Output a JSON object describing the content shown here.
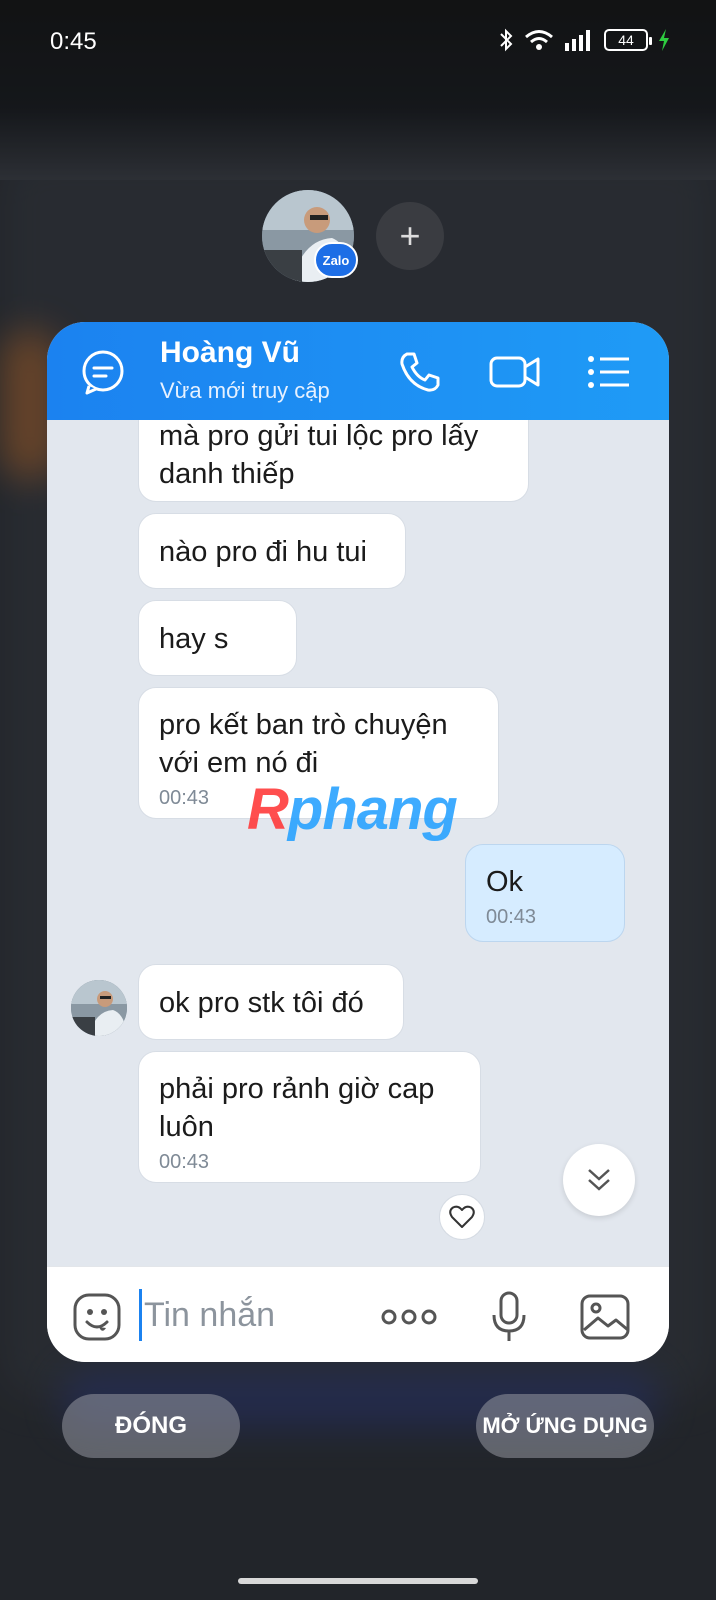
{
  "status_bar": {
    "time": "0:45",
    "battery": "44"
  },
  "bubble": {
    "badge": "Zalo",
    "add_label": "+"
  },
  "header": {
    "name": "Hoàng Vũ",
    "status": "Vừa mới truy cập"
  },
  "messages": [
    {
      "text": "mà pro gửi tui lộc pro lấy danh thiếp",
      "time": ""
    },
    {
      "text": "nào pro đi hu tui",
      "time": ""
    },
    {
      "text": "hay s",
      "time": ""
    },
    {
      "text": "pro kết ban trò chuyện với em nó đi",
      "time": "00:43"
    },
    {
      "text": "Ok",
      "time": "00:43"
    },
    {
      "text": "ok pro stk tôi đó",
      "time": ""
    },
    {
      "text": "phải pro rảnh giờ cap luôn",
      "time": "00:43"
    }
  ],
  "watermark": {
    "part1": "R",
    "part2": "phang"
  },
  "input": {
    "placeholder": "Tin nhắn"
  },
  "buttons": {
    "close": "ĐÓNG",
    "open_app": "MỞ ỨNG DỤNG"
  },
  "colors": {
    "header": "#1b82f0",
    "my_bubble": "#d6ecff",
    "chat_bg": "#e2e7ee"
  }
}
